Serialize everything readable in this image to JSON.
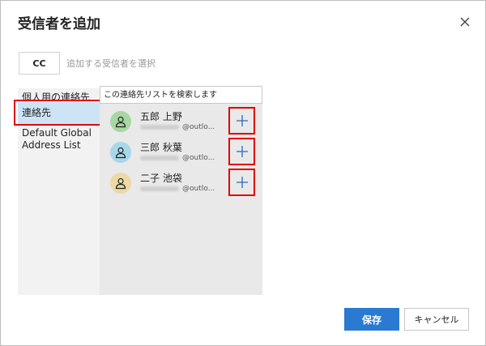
{
  "dialog": {
    "title": "受信者を追加",
    "close_icon": "close-icon"
  },
  "recipient": {
    "type_label": "CC",
    "placeholder": "追加する受信者を選択"
  },
  "sources": {
    "items": [
      {
        "label": "個人用の連絡先",
        "selected": false
      },
      {
        "label": "連絡先",
        "selected": true
      },
      {
        "label": "Default Global",
        "selected": false
      },
      {
        "label": "Address List",
        "selected": false
      }
    ]
  },
  "search": {
    "placeholder": "この連絡先リストを検索します"
  },
  "contacts": [
    {
      "name": "五郎 上野",
      "email_suffix": "@outlo...",
      "avatar_color": "#a7d7a1",
      "add_icon": "plus-icon"
    },
    {
      "name": "三郎 秋葉",
      "email_suffix": "@outlo...",
      "avatar_color": "#a8d8e8",
      "add_icon": "plus-icon"
    },
    {
      "name": "二子 池袋",
      "email_suffix": "@outlo...",
      "avatar_color": "#ecd9a6",
      "add_icon": "plus-icon"
    }
  ],
  "footer": {
    "save_label": "保存",
    "cancel_label": "キャンセル"
  },
  "colors": {
    "accent": "#2a7ad1",
    "selected_bg": "#cde4f7",
    "highlight": "#e00000"
  }
}
